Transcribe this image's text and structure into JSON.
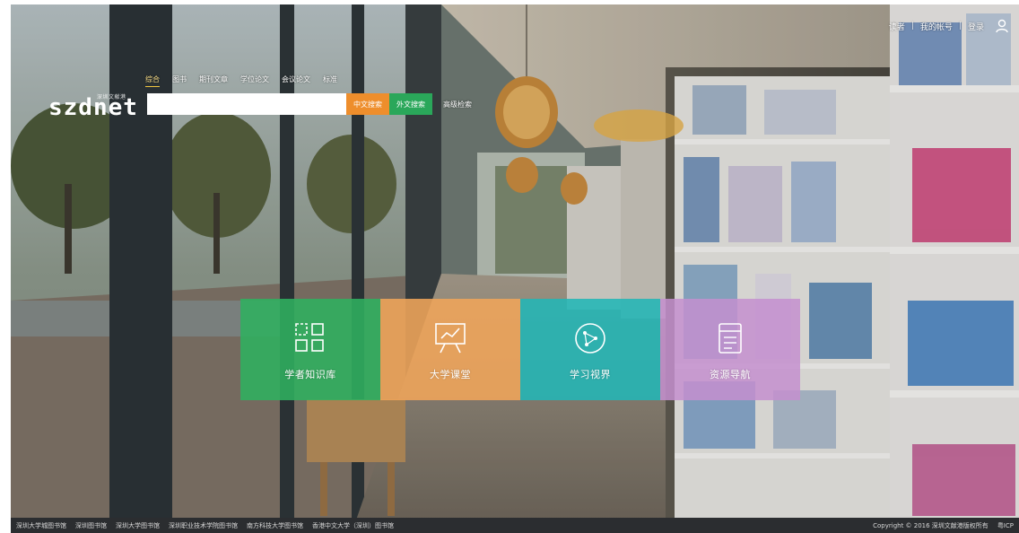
{
  "header": {
    "nav_links": [
      "读者",
      "我的帐号",
      "登录"
    ],
    "brand_text": "szdnet",
    "brand_sub": "深圳文献港"
  },
  "search": {
    "tabs": [
      "综合",
      "图书",
      "期刊文章",
      "学位论文",
      "会议论文",
      "标准"
    ],
    "active_tab": "综合",
    "placeholder": "",
    "value": "",
    "btn_cn": "中文搜索",
    "btn_en": "外文搜索",
    "advanced": "高级检索"
  },
  "tiles": [
    {
      "label": "学者知识库",
      "color": "#2fb060",
      "icon": "grid-icon"
    },
    {
      "label": "大学课堂",
      "color": "#f0a55a",
      "icon": "presentation-board-icon"
    },
    {
      "label": "学习视界",
      "color": "#22b6b6",
      "icon": "network-circle-icon"
    },
    {
      "label": "资源导航",
      "color": "#c48fcf",
      "icon": "document-list-icon"
    }
  ],
  "footer": {
    "links": [
      "深圳大学城图书馆",
      "深圳图书馆",
      "深圳大学图书馆",
      "深圳职业技术学院图书馆",
      "南方科技大学图书馆",
      "香港中文大学（深圳）图书馆"
    ],
    "copyright": "Copyright © 2016 深圳文献港版权所有",
    "beian": "粤ICP"
  }
}
